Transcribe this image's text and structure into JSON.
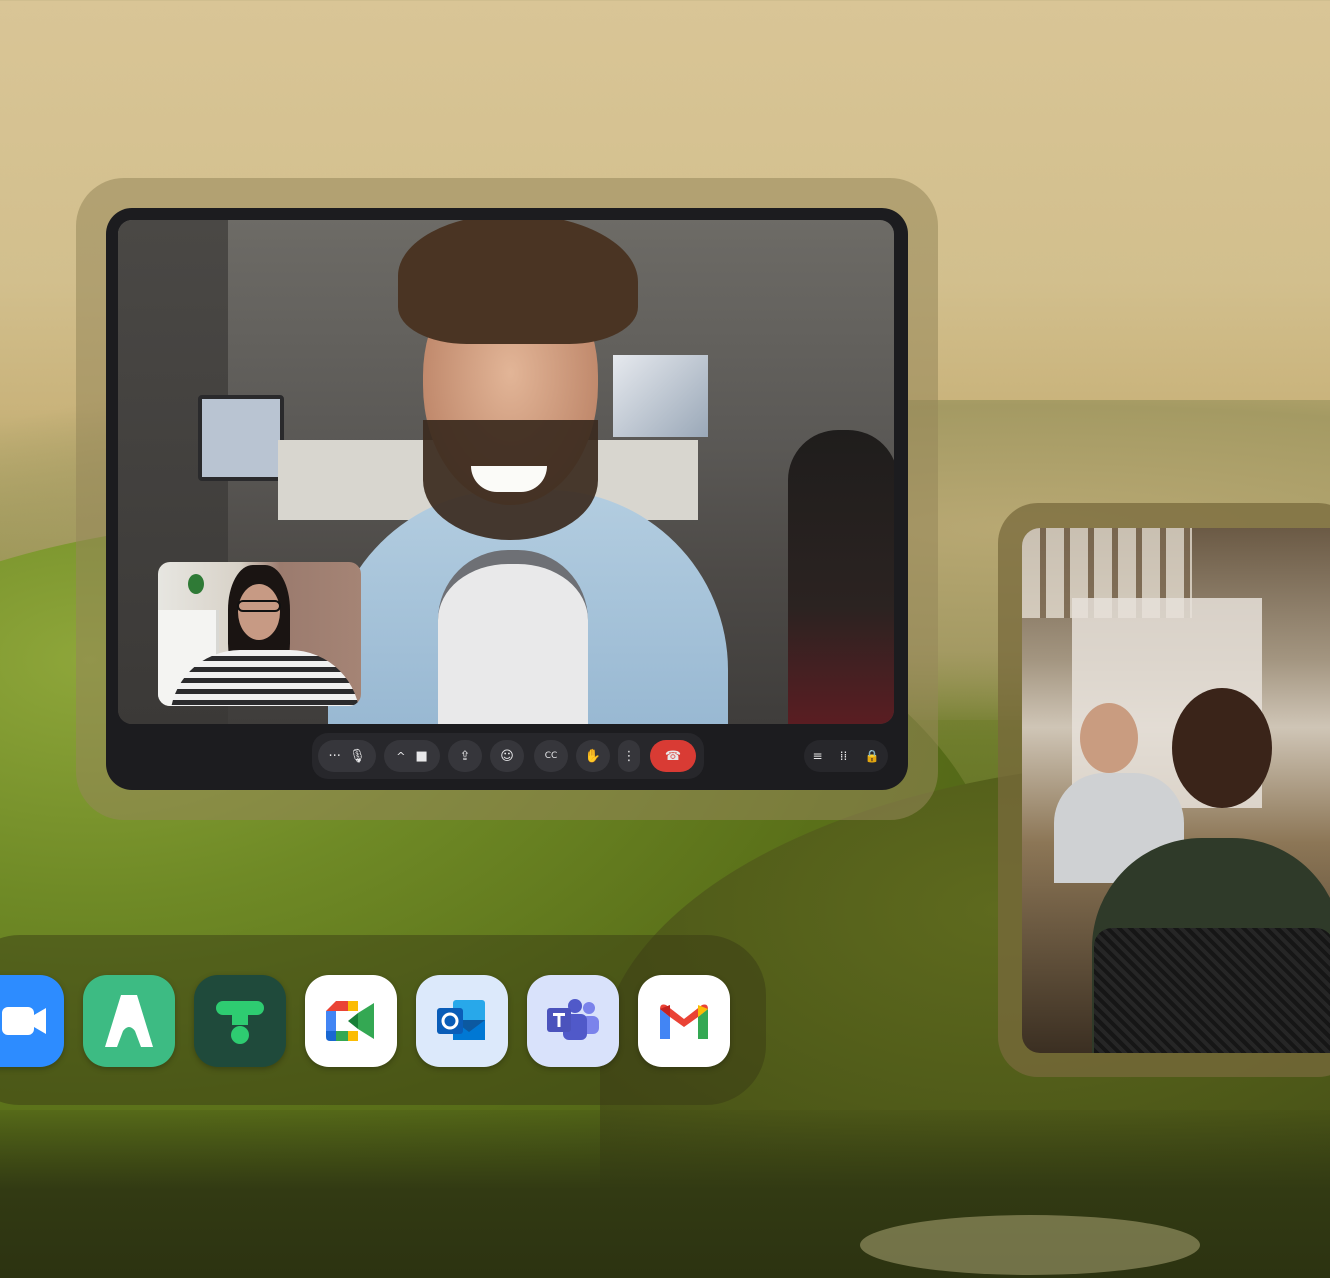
{
  "colors": {
    "end_call": "#d93b34",
    "call_bar": "#27272b",
    "call_window": "#1c1c1f",
    "zoom_blue": "#2d8cff",
    "teal_green": "#3dbb83",
    "dark_green": "#1f4a3b"
  },
  "call": {
    "controls": [
      {
        "name": "more-options-icon",
        "glyph": "···"
      },
      {
        "name": "microphone-icon",
        "glyph": "🎙"
      },
      {
        "name": "chevron-up-icon",
        "glyph": "^"
      },
      {
        "name": "camera-icon",
        "glyph": "■"
      },
      {
        "name": "present-screen-icon",
        "glyph": "⇪"
      },
      {
        "name": "emoji-icon",
        "glyph": "☺"
      },
      {
        "name": "captions-icon",
        "glyph": "CC"
      },
      {
        "name": "raise-hand-icon",
        "glyph": "✋"
      },
      {
        "name": "vertical-more-icon",
        "glyph": "⋮"
      },
      {
        "name": "end-call-icon",
        "glyph": "☎"
      }
    ],
    "side_controls": [
      {
        "name": "chat-icon",
        "glyph": "≡"
      },
      {
        "name": "activities-icon",
        "glyph": "⁞⁞"
      },
      {
        "name": "host-controls-icon",
        "glyph": "🔒"
      }
    ]
  },
  "dock": {
    "apps": [
      {
        "name": "zoom-app-icon",
        "bg": "#2d8cff"
      },
      {
        "name": "avoma-app-icon",
        "bg": "#3dbb83"
      },
      {
        "name": "fireflies-app-icon",
        "bg": "#1f4a3b"
      },
      {
        "name": "google-meet-app-icon",
        "bg": "#ffffff"
      },
      {
        "name": "outlook-app-icon",
        "bg": "#dce9fb"
      },
      {
        "name": "teams-app-icon",
        "bg": "#d9e2fb"
      },
      {
        "name": "gmail-app-icon",
        "bg": "#ffffff"
      }
    ]
  }
}
